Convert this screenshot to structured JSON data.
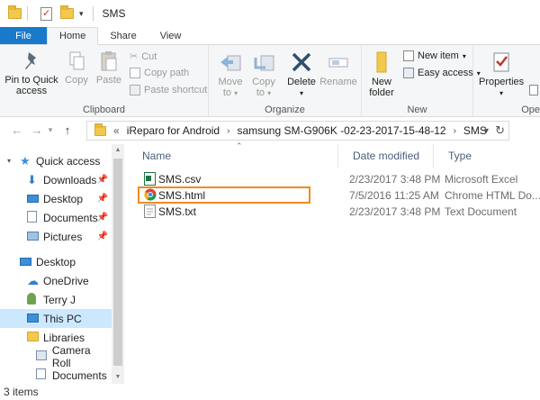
{
  "window": {
    "title": "SMS"
  },
  "tabs": [
    "File",
    "Home",
    "Share",
    "View"
  ],
  "ribbon": {
    "clipboard": {
      "label": "Clipboard",
      "pin_quick_access_1": "Pin to Quick",
      "pin_quick_access_2": "access",
      "copy": "Copy",
      "paste": "Paste",
      "cut": "Cut",
      "copy_path": "Copy path",
      "paste_shortcut": "Paste shortcut"
    },
    "organize": {
      "label": "Organize",
      "move_to": "Move",
      "move_to_2": "to",
      "copy_to": "Copy",
      "copy_to_2": "to",
      "delete": "Delete",
      "rename": "Rename"
    },
    "new": {
      "label": "New",
      "new_folder_1": "New",
      "new_folder_2": "folder",
      "new_item": "New item",
      "easy_access": "Easy access"
    },
    "open": {
      "label": "Ope",
      "properties": "Properties"
    }
  },
  "address": {
    "overflow": "«",
    "segments": [
      "iReparo for Android",
      "samsung SM-G906K -02-23-2017-15-48-12",
      "SMS"
    ]
  },
  "nav": {
    "items": [
      {
        "label": "Quick access",
        "pinned": false
      },
      {
        "label": "Downloads",
        "pinned": true
      },
      {
        "label": "Desktop",
        "pinned": true
      },
      {
        "label": "Documents",
        "pinned": true
      },
      {
        "label": "Pictures",
        "pinned": true
      },
      {
        "label": "Desktop",
        "pinned": false
      },
      {
        "label": "OneDrive",
        "pinned": false
      },
      {
        "label": "Terry J",
        "pinned": false
      },
      {
        "label": "This PC",
        "pinned": false
      },
      {
        "label": "Libraries",
        "pinned": false
      },
      {
        "label": "Camera Roll",
        "pinned": false
      },
      {
        "label": "Documents",
        "pinned": false
      }
    ]
  },
  "columns": {
    "name": "Name",
    "date": "Date modified",
    "type": "Type"
  },
  "files": [
    {
      "name": "SMS.csv",
      "date": "2/23/2017 3:48 PM",
      "type": "Microsoft Excel",
      "icon": "excel-icon"
    },
    {
      "name": "SMS.html",
      "date": "7/5/2016 11:25 AM",
      "type": "Chrome HTML Do...",
      "icon": "chrome-icon"
    },
    {
      "name": "SMS.txt",
      "date": "2/23/2017 3:48 PM",
      "type": "Text Document",
      "icon": "text-file-icon"
    }
  ],
  "status": {
    "item_count": "3 items"
  },
  "colors": {
    "file_tab": "#1979ca",
    "selection": "#cce8ff",
    "highlight_box": "#f28b1a"
  }
}
